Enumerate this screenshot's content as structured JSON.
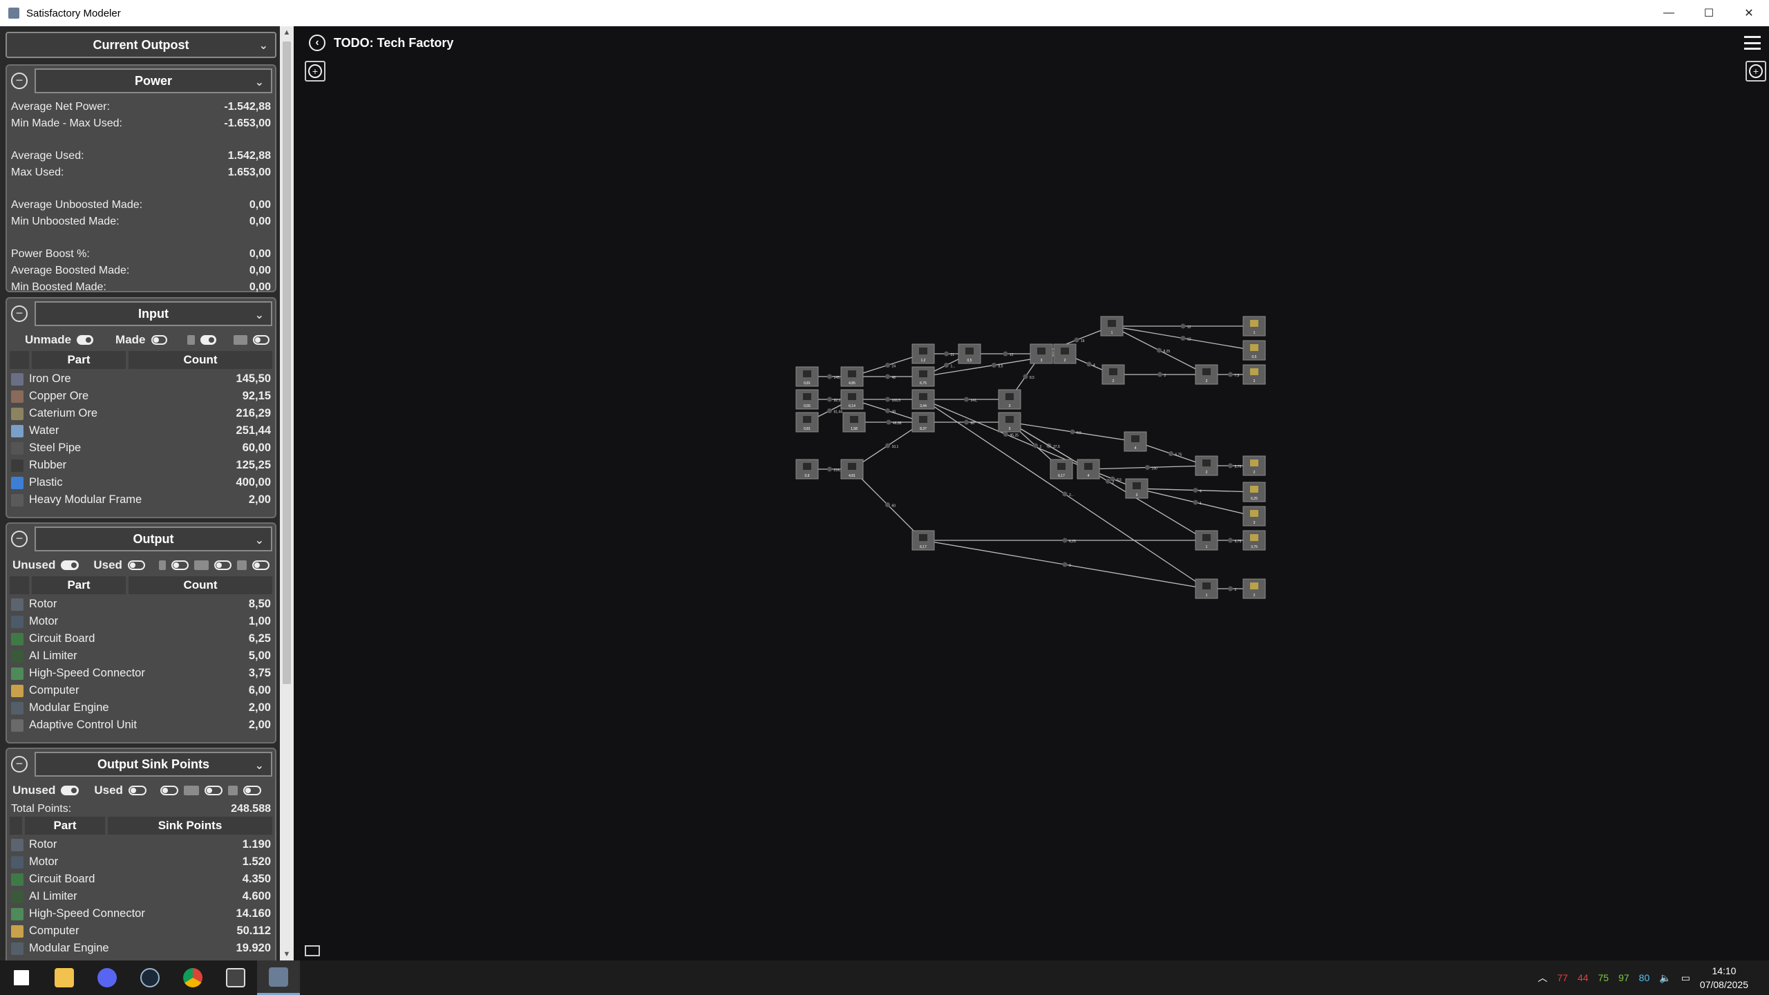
{
  "window": {
    "title": "Satisfactory Modeler"
  },
  "sidebar": {
    "outpost_dropdown": "Current Outpost",
    "power": {
      "header": "Power",
      "rows": [
        {
          "label": "Average Net Power:",
          "value": "-1.542,88"
        },
        {
          "label": "Min Made - Max Used:",
          "value": "-1.653,00"
        },
        {
          "label": "Average Used:",
          "value": "1.542,88"
        },
        {
          "label": "Max Used:",
          "value": "1.653,00"
        },
        {
          "label": "Average Unboosted Made:",
          "value": "0,00"
        },
        {
          "label": "Min Unboosted Made:",
          "value": "0,00"
        },
        {
          "label": "Power Boost %:",
          "value": "0,00"
        },
        {
          "label": "Average Boosted Made:",
          "value": "0,00"
        },
        {
          "label": "Min Boosted Made:",
          "value": "0,00"
        }
      ]
    },
    "input": {
      "header": "Input",
      "toggle1": "Unmade",
      "toggle2": "Made",
      "col_part": "Part",
      "col_count": "Count",
      "items": [
        {
          "name": "Iron Ore",
          "value": "145,50",
          "color": "#6b6f86"
        },
        {
          "name": "Copper Ore",
          "value": "92,15",
          "color": "#8a6a5a"
        },
        {
          "name": "Caterium Ore",
          "value": "216,29",
          "color": "#8c8360"
        },
        {
          "name": "Water",
          "value": "251,44",
          "color": "#7aa0c8"
        },
        {
          "name": "Steel Pipe",
          "value": "60,00",
          "color": "#555555"
        },
        {
          "name": "Rubber",
          "value": "125,25",
          "color": "#3b3b3b"
        },
        {
          "name": "Plastic",
          "value": "400,00",
          "color": "#3d7fd6"
        },
        {
          "name": "Heavy Modular Frame",
          "value": "2,00",
          "color": "#5a5a5a"
        }
      ]
    },
    "output": {
      "header": "Output",
      "toggle1": "Unused",
      "toggle2": "Used",
      "col_part": "Part",
      "col_count": "Count",
      "items": [
        {
          "name": "Rotor",
          "value": "8,50",
          "color": "#5c6470"
        },
        {
          "name": "Motor",
          "value": "1,00",
          "color": "#4d5a6a"
        },
        {
          "name": "Circuit Board",
          "value": "6,25",
          "color": "#3f7a46"
        },
        {
          "name": "AI Limiter",
          "value": "5,00",
          "color": "#3a5a3a"
        },
        {
          "name": "High-Speed Connector",
          "value": "3,75",
          "color": "#4f8a5a"
        },
        {
          "name": "Computer",
          "value": "6,00",
          "color": "#c9a14a"
        },
        {
          "name": "Modular Engine",
          "value": "2,00",
          "color": "#555f6a"
        },
        {
          "name": "Adaptive Control Unit",
          "value": "2,00",
          "color": "#6a6a6a"
        }
      ]
    },
    "sink": {
      "header": "Output Sink Points",
      "toggle1": "Unused",
      "toggle2": "Used",
      "total_label": "Total Points:",
      "total_value": "248.588",
      "col_part": "Part",
      "col_points": "Sink Points",
      "items": [
        {
          "name": "Rotor",
          "value": "1.190",
          "color": "#5c6470"
        },
        {
          "name": "Motor",
          "value": "1.520",
          "color": "#4d5a6a"
        },
        {
          "name": "Circuit Board",
          "value": "4.350",
          "color": "#3f7a46"
        },
        {
          "name": "AI Limiter",
          "value": "4.600",
          "color": "#3a5a3a"
        },
        {
          "name": "High-Speed Connector",
          "value": "14.160",
          "color": "#4f8a5a"
        },
        {
          "name": "Computer",
          "value": "50.112",
          "color": "#c9a14a"
        },
        {
          "name": "Modular Engine",
          "value": "19.920",
          "color": "#555f6a"
        }
      ]
    }
  },
  "canvas": {
    "title": "TODO: Tech Factory",
    "node_color": "#5e5e5e",
    "edge_color": "#bdbdbd",
    "nodes": [
      {
        "id": "a1",
        "label": "0,81"
      },
      {
        "id": "a2",
        "label": "0,55"
      },
      {
        "id": "a3",
        "label": "0,81"
      },
      {
        "id": "a4",
        "label": "0,9"
      },
      {
        "id": "b1",
        "label": "4,85"
      },
      {
        "id": "b2",
        "label": "6,14"
      },
      {
        "id": "b3",
        "label": "1,58"
      },
      {
        "id": "b4",
        "label": "4,81"
      },
      {
        "id": "c1",
        "label": "1,2"
      },
      {
        "id": "c2",
        "label": "6,75"
      },
      {
        "id": "c3",
        "label": "3,44"
      },
      {
        "id": "c4",
        "label": "8,37"
      },
      {
        "id": "c5",
        "label": "6,17"
      },
      {
        "id": "d1",
        "label": "0,5"
      },
      {
        "id": "e1",
        "label": "3"
      },
      {
        "id": "e2",
        "label": "3"
      },
      {
        "id": "e3",
        "label": "3"
      },
      {
        "id": "f1",
        "label": "2"
      },
      {
        "id": "f2",
        "label": "6,17"
      },
      {
        "id": "g1",
        "label": "1"
      },
      {
        "id": "g2",
        "label": "2"
      },
      {
        "id": "h1",
        "label": "4"
      },
      {
        "id": "h2",
        "label": "3"
      },
      {
        "id": "h3",
        "label": "4"
      },
      {
        "id": "i1",
        "label": "2"
      },
      {
        "id": "i2",
        "label": "2"
      },
      {
        "id": "i3",
        "label": "1"
      },
      {
        "id": "i4",
        "label": "1"
      },
      {
        "id": "o1",
        "label": "1"
      },
      {
        "id": "o2",
        "label": "0,5"
      },
      {
        "id": "o3",
        "label": "2"
      },
      {
        "id": "o4",
        "label": "2"
      },
      {
        "id": "o5",
        "label": "6,25"
      },
      {
        "id": "o6",
        "label": "3"
      },
      {
        "id": "o7",
        "label": "3,75"
      },
      {
        "id": "o8",
        "label": "2"
      }
    ],
    "edge_labels": [
      "145,5",
      "92,15",
      "61,44",
      "216,",
      "24",
      "48",
      "169,5",
      "38",
      "46,88",
      "10,1",
      "60",
      "21",
      "1...",
      "141,",
      "95,25",
      "60",
      "2...",
      "12",
      "10",
      "15",
      "4",
      "8,5",
      "8,5",
      "2",
      "12",
      "12",
      "8,25",
      "2",
      "7,5",
      "37,5",
      "190",
      "6,75",
      "4",
      "1",
      "8,5",
      "2",
      "5,75",
      "6,25",
      "3",
      "3,75",
      "2",
      "8,5",
      "240",
      "4",
      "2",
      "15"
    ]
  },
  "taskbar": {
    "tray_values": [
      "77",
      "44",
      "75",
      "97",
      "80"
    ],
    "tray_colors": [
      "#e04040",
      "#e04040",
      "#7ac943",
      "#7ac943",
      "#4fc3f7"
    ],
    "time": "14:10",
    "date": "07/08/2025"
  }
}
